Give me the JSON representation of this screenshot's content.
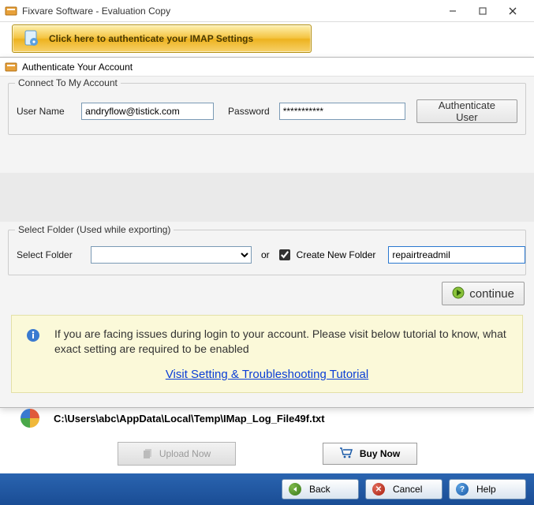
{
  "window": {
    "title": "Fixvare Software - Evaluation Copy"
  },
  "goldbar": {
    "label": "Click here to authenticate your IMAP Settings"
  },
  "auth_panel": {
    "title": "Authenticate Your Account",
    "group1_legend": "Connect To My Account",
    "username_label": "User Name",
    "username_value": "andryflow@tistick.com",
    "password_label": "Password",
    "password_value": "***********",
    "auth_button": "Authenticate User",
    "group2_legend": "Select Folder (Used while exporting)",
    "select_folder_label": "Select Folder",
    "select_folder_value": "",
    "or_text": "or",
    "create_folder_label": "Create New Folder",
    "create_folder_checked": true,
    "new_folder_value": "repairtreadmil",
    "continue_label": "continue",
    "info_text": "If you are facing issues during login to your account. Please visit below tutorial to know, what exact setting are required to be enabled",
    "tutorial_link": "Visit Setting & Troubleshooting Tutorial"
  },
  "log_path": "C:\\Users\\abc\\AppData\\Local\\Temp\\IMap_Log_File49f.txt",
  "upload_label": "Upload Now",
  "buynow_label": "Buy Now",
  "footer": {
    "back": "Back",
    "cancel": "Cancel",
    "help": "Help"
  }
}
